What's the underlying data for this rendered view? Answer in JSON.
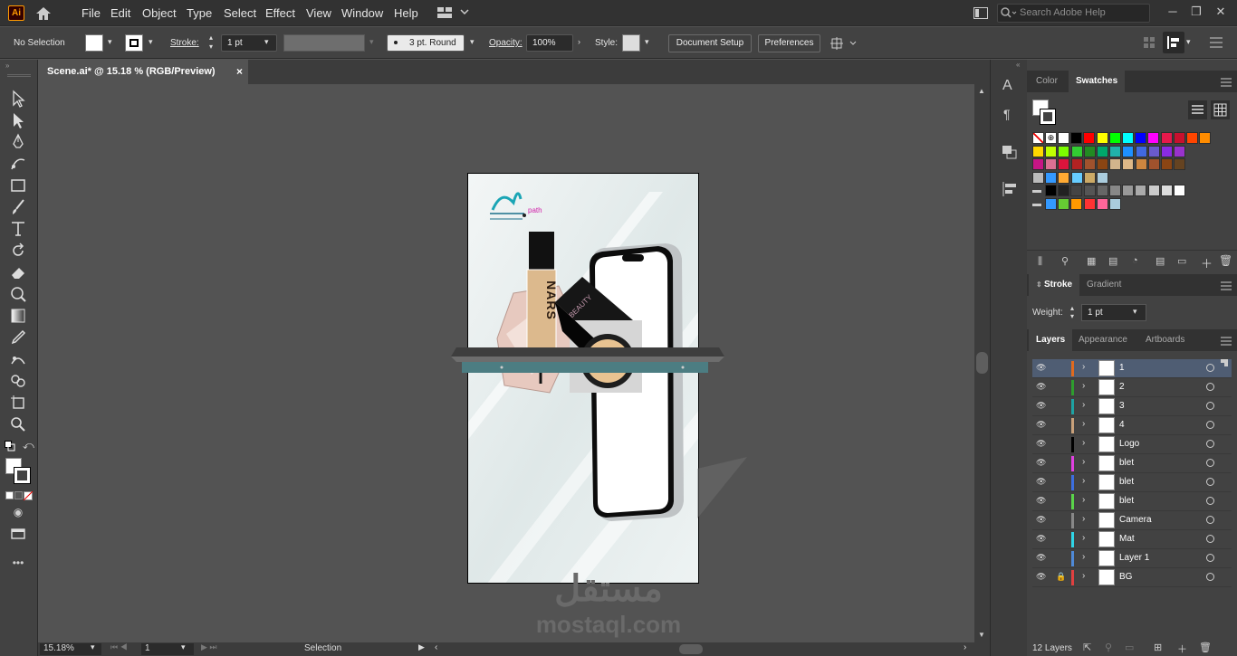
{
  "app": {
    "logo": "Ai"
  },
  "menu": [
    "File",
    "Edit",
    "Object",
    "Type",
    "Select",
    "Effect",
    "View",
    "Window",
    "Help"
  ],
  "search": {
    "placeholder": "Search Adobe Help"
  },
  "control": {
    "selection": "No Selection",
    "stroke_label": "Stroke:",
    "stroke_value": "1 pt",
    "brush": "3 pt. Round",
    "opacity_label": "Opacity:",
    "opacity_value": "100%",
    "style_label": "Style:",
    "doc_setup": "Document Setup",
    "preferences": "Preferences"
  },
  "document_tab": {
    "title": "Scene.ai* @ 15.18 % (RGB/Preview)",
    "close": "×"
  },
  "status": {
    "zoom": "15.18%",
    "artboard": "1",
    "tool": "Selection"
  },
  "artwork": {
    "logo_text": "path",
    "product_text": "NARS",
    "brand_text": "BEAUTY"
  },
  "watermark": {
    "arabic": "مستقل",
    "latin": "mostaql.com"
  },
  "panels": {
    "color_tabs": [
      "Color",
      "Swatches"
    ],
    "stroke_tabs": [
      "Stroke",
      "Gradient"
    ],
    "weight_label": "Weight:",
    "weight_value": "1 pt",
    "layer_tabs": [
      "Layers",
      "Appearance",
      "Artboards"
    ],
    "layer_count": "12 Layers"
  },
  "layers": [
    {
      "name": "1",
      "color": "#e06a1e",
      "selected": true,
      "locked": false
    },
    {
      "name": "2",
      "color": "#2e9d2e",
      "selected": false,
      "locked": false
    },
    {
      "name": "3",
      "color": "#1ea3a3",
      "selected": false,
      "locked": false
    },
    {
      "name": "4",
      "color": "#c8a07a",
      "selected": false,
      "locked": false
    },
    {
      "name": "Logo",
      "color": "#000000",
      "selected": false,
      "locked": false
    },
    {
      "name": "blet",
      "color": "#e040e0",
      "selected": false,
      "locked": false
    },
    {
      "name": "blet",
      "color": "#3c6fe0",
      "selected": false,
      "locked": false
    },
    {
      "name": "blet",
      "color": "#5ad44a",
      "selected": false,
      "locked": false
    },
    {
      "name": "Camera",
      "color": "#888888",
      "selected": false,
      "locked": false
    },
    {
      "name": "Mat",
      "color": "#2fd5e6",
      "selected": false,
      "locked": false
    },
    {
      "name": "Layer 1",
      "color": "#4f8ad8",
      "selected": false,
      "locked": false
    },
    {
      "name": "BG",
      "color": "#e04040",
      "selected": false,
      "locked": true
    }
  ],
  "swatch_rows": [
    [
      "#ffffff",
      "#000000",
      "#ff0000",
      "#ffff00",
      "#00ff00",
      "#00ffff",
      "#0000ff",
      "#ff00ff",
      "#e6194b",
      "#c8102e",
      "#ff4500",
      "#ff8c00"
    ],
    [
      "#ffd700",
      "#bfff00",
      "#7cfc00",
      "#32cd32",
      "#228b22",
      "#00a86b",
      "#20b2aa",
      "#1e90ff",
      "#4169e1",
      "#6a5acd",
      "#8a2be2",
      "#9932cc"
    ],
    [
      "#c71585",
      "#db7093",
      "#dc143c",
      "#b22222",
      "#a0522d",
      "#8b4513",
      "#d2b48c",
      "#deb887",
      "#cd853f",
      "#a0522d",
      "#8b4513",
      "#654321"
    ],
    [
      "#bbbbbb",
      "#3399ff",
      "#ffaa33",
      "#66ccff",
      "#ccaa66",
      "#aaccdd"
    ],
    [
      "#000000",
      "#222222",
      "#444444",
      "#555555",
      "#666666",
      "#888888",
      "#999999",
      "#aaaaaa",
      "#cccccc",
      "#dddddd",
      "#ffffff"
    ],
    [
      "#3399ff",
      "#66cc33",
      "#ff9900",
      "#ff3333",
      "#ff6699",
      "#aaccdd"
    ]
  ]
}
